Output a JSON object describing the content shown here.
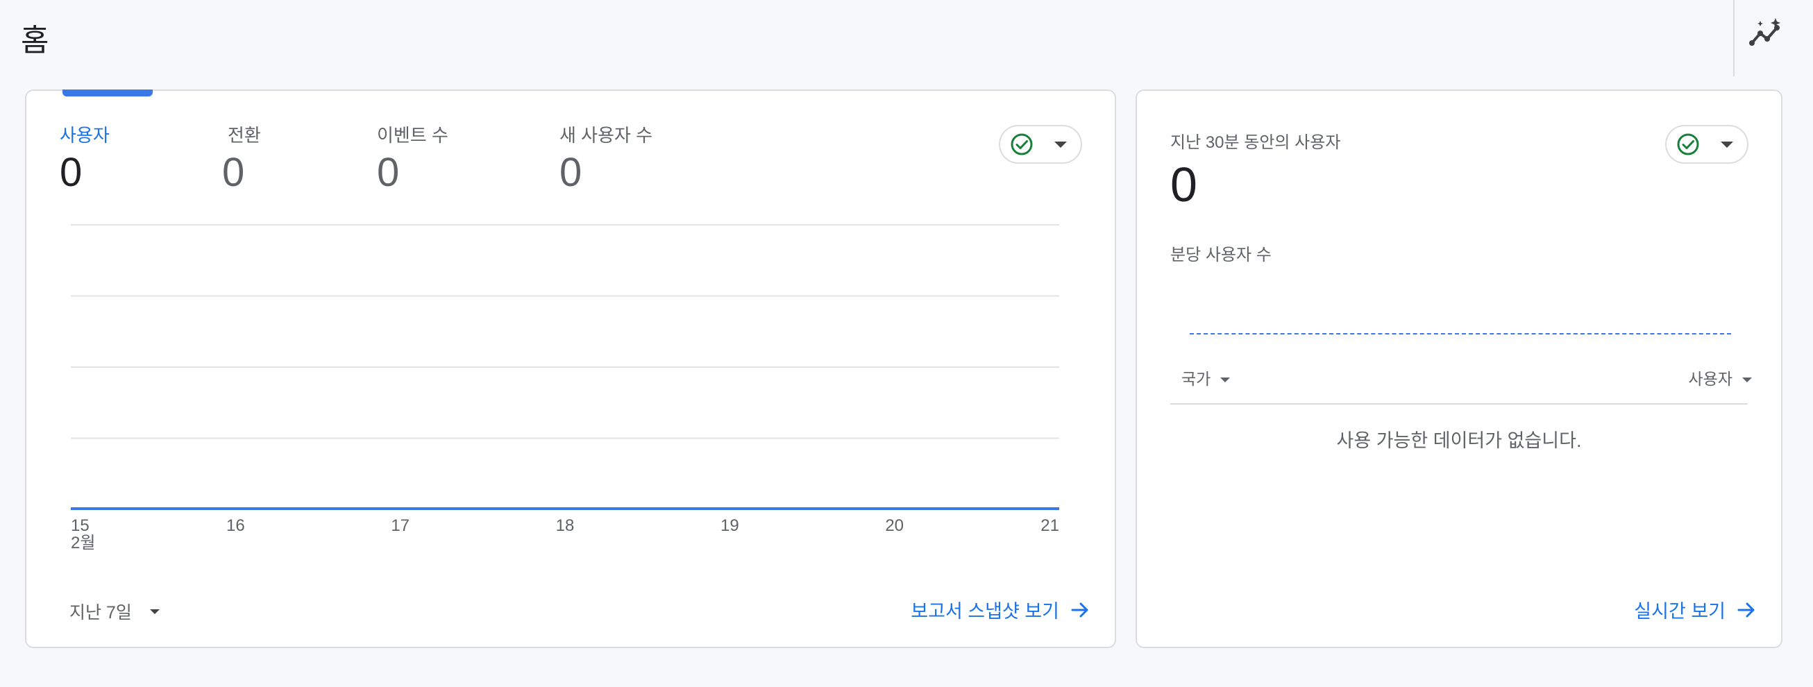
{
  "page": {
    "title": "홈"
  },
  "overview": {
    "metrics": [
      {
        "label": "사용자",
        "value": "0",
        "active": true
      },
      {
        "label": "전환",
        "value": "0",
        "active": false
      },
      {
        "label": "이벤트 수",
        "value": "0",
        "active": false
      },
      {
        "label": "새 사용자 수",
        "value": "0",
        "active": false
      }
    ],
    "date_range": "지난 7일",
    "report_link": "보고서 스냅샷 보기"
  },
  "chart_data": {
    "type": "line",
    "x": [
      "15",
      "16",
      "17",
      "18",
      "19",
      "20",
      "21"
    ],
    "x_sub": "2월",
    "series": [
      {
        "values": [
          0,
          0,
          0,
          0,
          0,
          0,
          0
        ]
      }
    ],
    "grid": true
  },
  "realtime": {
    "title": "지난 30분 동안의 사용자",
    "value": "0",
    "subtitle": "분당 사용자 수",
    "column_left": "국가",
    "column_right": "사용자",
    "empty": "사용 가능한 데이터가 없습니다.",
    "link": "실시간 보기"
  },
  "colors": {
    "accent": "#1a73e8",
    "line": "#3b78e7",
    "check": "#188038"
  },
  "icons": [
    "insights-icon",
    "check-circle-icon",
    "chevron-down-icon",
    "arrow-right-icon"
  ]
}
